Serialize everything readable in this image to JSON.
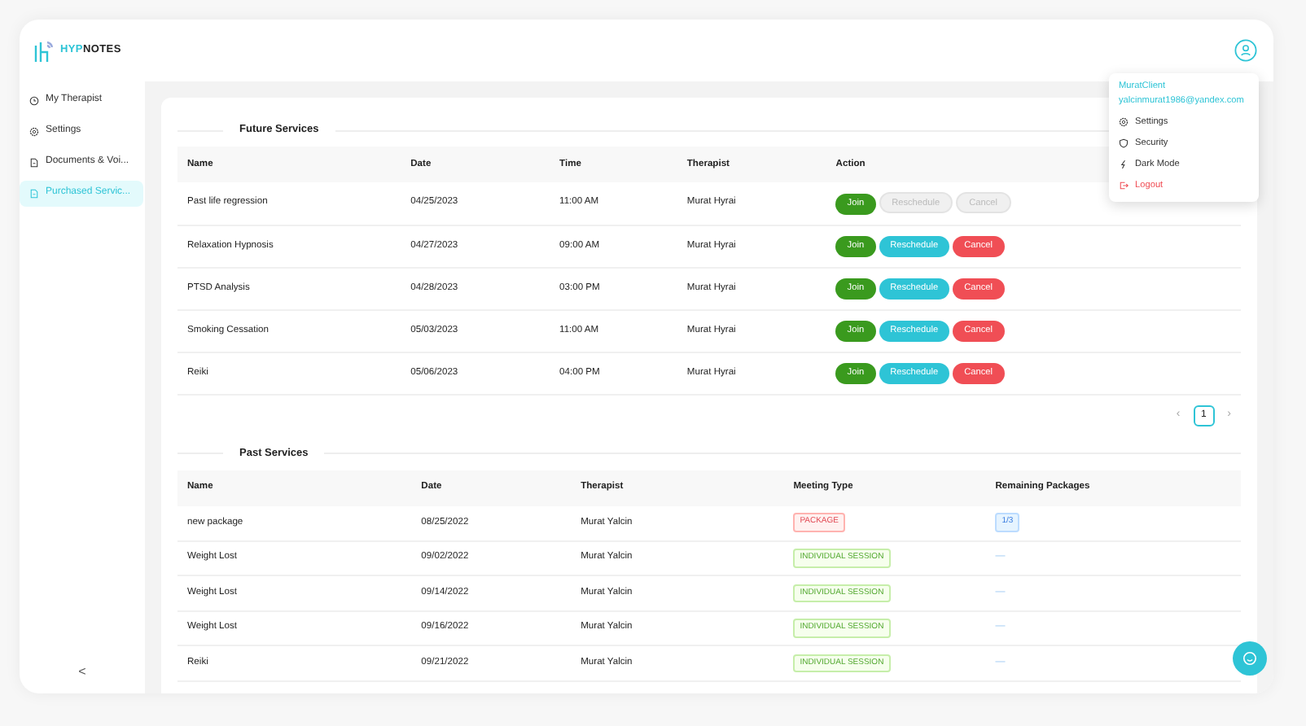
{
  "header": {
    "logo": {
      "accent": "HYP",
      "rest": "NOTES"
    }
  },
  "sidebar": {
    "items": [
      {
        "label": "My Therapist",
        "kind": "clock",
        "selected": false
      },
      {
        "label": "Settings",
        "kind": "gear",
        "selected": false
      },
      {
        "label": "Documents & Voi...",
        "kind": "file",
        "selected": false
      },
      {
        "label": "Purchased Servic...",
        "kind": "file",
        "selected": true
      }
    ],
    "collapse": "<"
  },
  "future_services": {
    "title": "Future Services",
    "columns": [
      "Name",
      "Date",
      "Time",
      "Therapist",
      "Action"
    ],
    "rows": [
      {
        "name": "Past life regression",
        "date": "04/25/2023",
        "time": "11:00 AM",
        "therapist": "Murat Hyrai",
        "actions": [
          {
            "label": "Join",
            "kind": "join",
            "disabled": false
          },
          {
            "label": "Reschedule",
            "kind": "reschedule",
            "disabled": true
          },
          {
            "label": "Cancel",
            "kind": "cancel",
            "disabled": true
          }
        ]
      },
      {
        "name": "Relaxation Hypnosis",
        "date": "04/27/2023",
        "time": "09:00 AM",
        "therapist": "Murat Hyrai",
        "actions": [
          {
            "label": "Join",
            "kind": "join",
            "disabled": false
          },
          {
            "label": "Reschedule",
            "kind": "reschedule",
            "disabled": false
          },
          {
            "label": "Cancel",
            "kind": "cancel",
            "disabled": false
          }
        ]
      },
      {
        "name": "PTSD Analysis",
        "date": "04/28/2023",
        "time": "03:00 PM",
        "therapist": "Murat Hyrai",
        "actions": [
          {
            "label": "Join",
            "kind": "join",
            "disabled": false
          },
          {
            "label": "Reschedule",
            "kind": "reschedule",
            "disabled": false
          },
          {
            "label": "Cancel",
            "kind": "cancel",
            "disabled": false
          }
        ]
      },
      {
        "name": "Smoking Cessation",
        "date": "05/03/2023",
        "time": "11:00 AM",
        "therapist": "Murat Hyrai",
        "actions": [
          {
            "label": "Join",
            "kind": "join",
            "disabled": false
          },
          {
            "label": "Reschedule",
            "kind": "reschedule",
            "disabled": false
          },
          {
            "label": "Cancel",
            "kind": "cancel",
            "disabled": false
          }
        ]
      },
      {
        "name": "Reiki",
        "date": "05/06/2023",
        "time": "04:00 PM",
        "therapist": "Murat Hyrai",
        "actions": [
          {
            "label": "Join",
            "kind": "join",
            "disabled": false
          },
          {
            "label": "Reschedule",
            "kind": "reschedule",
            "disabled": false
          },
          {
            "label": "Cancel",
            "kind": "cancel",
            "disabled": false
          }
        ]
      }
    ],
    "pagination": {
      "prev": "‹",
      "pages": [
        {
          "label": "1",
          "selected": true
        }
      ],
      "next": "›"
    }
  },
  "past_services": {
    "title": "Past Services",
    "columns": [
      "Name",
      "Date",
      "Therapist",
      "Meeting Type",
      "Remaining Packages"
    ],
    "rows": [
      {
        "name": "new package",
        "date": "08/25/2022",
        "therapist": "Murat Yalcin",
        "meeting_type": {
          "label": "PACKAGE",
          "kind": "package"
        },
        "remaining": {
          "text": "1/3",
          "kind": "badge"
        }
      },
      {
        "name": "Weight Lost",
        "date": "09/02/2022",
        "therapist": "Murat Yalcin",
        "meeting_type": {
          "label": "INDIVIDUAL SESSION",
          "kind": "individual"
        },
        "remaining": {
          "text": "—",
          "kind": "dash"
        }
      },
      {
        "name": "Weight Lost",
        "date": "09/14/2022",
        "therapist": "Murat Yalcin",
        "meeting_type": {
          "label": "INDIVIDUAL SESSION",
          "kind": "individual"
        },
        "remaining": {
          "text": "—",
          "kind": "dash"
        }
      },
      {
        "name": "Weight Lost",
        "date": "09/16/2022",
        "therapist": "Murat Yalcin",
        "meeting_type": {
          "label": "INDIVIDUAL SESSION",
          "kind": "individual"
        },
        "remaining": {
          "text": "—",
          "kind": "dash"
        }
      },
      {
        "name": "Reiki",
        "date": "09/21/2022",
        "therapist": "Murat Yalcin",
        "meeting_type": {
          "label": "INDIVIDUAL SESSION",
          "kind": "individual"
        },
        "remaining": {
          "text": "—",
          "kind": "dash"
        }
      }
    ]
  },
  "user_menu": {
    "username": "MuratClient",
    "email": "yalcinmurat1986@yandex.com",
    "items": [
      {
        "label": "Settings",
        "kind": "settings"
      },
      {
        "label": "Security",
        "kind": "security"
      },
      {
        "label": "Dark Mode",
        "kind": "dark"
      },
      {
        "label": "Logout",
        "kind": "logout"
      }
    ]
  }
}
